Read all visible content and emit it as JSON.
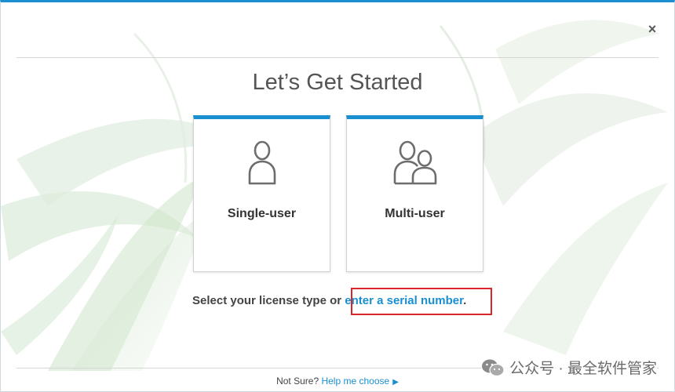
{
  "window": {
    "close_label": "×"
  },
  "header": {
    "title": "Let’s Get Started"
  },
  "cards": {
    "single": {
      "label": "Single-user",
      "icon": "single-user-icon"
    },
    "multi": {
      "label": "Multi-user",
      "icon": "multi-user-icon"
    }
  },
  "license": {
    "prompt": "Select your license type or ",
    "serial_link": "enter a serial number",
    "period": ".",
    "highlight_color": "#d9262a"
  },
  "footer": {
    "not_sure": "Not Sure? ",
    "help_link": "Help me choose",
    "arrow": "▶"
  },
  "watermark": {
    "text": "公众号 · 最全软件管家",
    "icon": "wechat-icon"
  },
  "colors": {
    "accent": "#1a8fd0",
    "title": "#555555"
  }
}
